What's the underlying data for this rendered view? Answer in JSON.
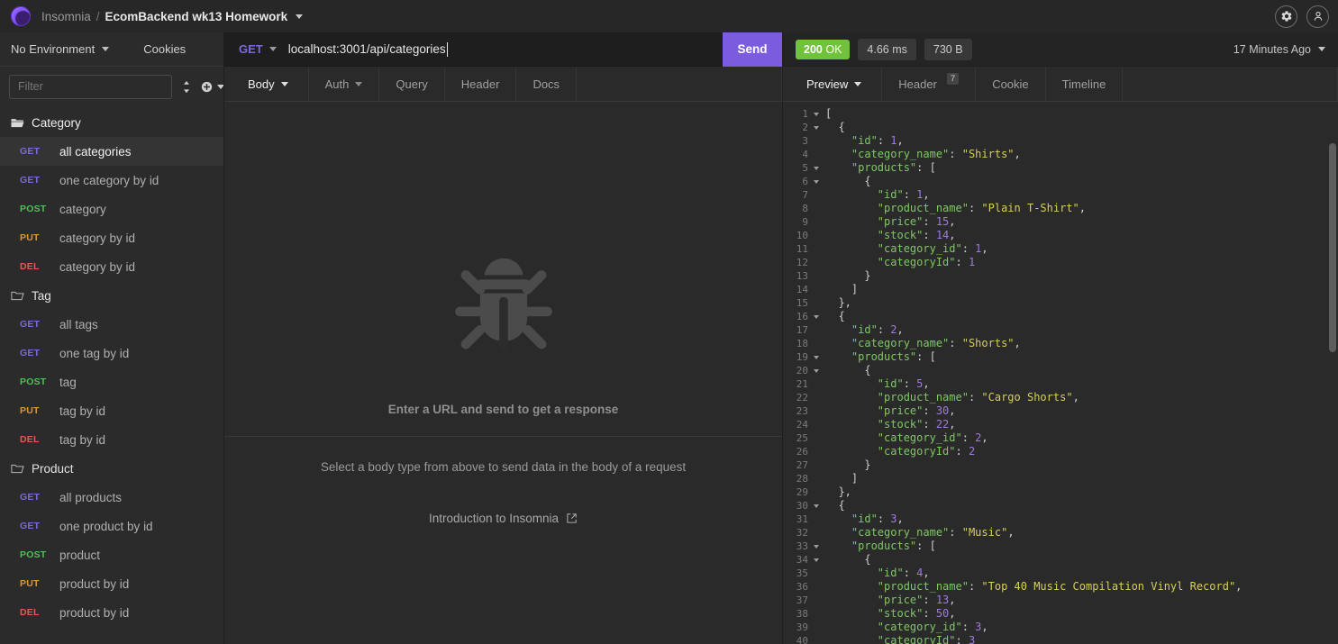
{
  "titlebar": {
    "app_name": "Insomnia",
    "separator": "/",
    "workspace": "EcomBackend wk13 Homework",
    "settings_icon": "gear-icon",
    "account_icon": "user-icon"
  },
  "sidebar": {
    "environment": "No Environment",
    "cookies": "Cookies",
    "filter_placeholder": "Filter",
    "sort_icon": "sort-icon",
    "add_icon": "plus-circle-icon",
    "folders": [
      {
        "name": "Category",
        "icon": "folder-open-icon",
        "expanded": true,
        "requests": [
          {
            "method": "GET",
            "label": "all categories",
            "selected": true
          },
          {
            "method": "GET",
            "label": "one category by id",
            "selected": false
          },
          {
            "method": "POST",
            "label": "category",
            "selected": false
          },
          {
            "method": "PUT",
            "label": "category by id",
            "selected": false
          },
          {
            "method": "DEL",
            "label": "category by id",
            "selected": false
          }
        ]
      },
      {
        "name": "Tag",
        "icon": "folder-icon",
        "expanded": true,
        "requests": [
          {
            "method": "GET",
            "label": "all tags",
            "selected": false
          },
          {
            "method": "GET",
            "label": "one tag by id",
            "selected": false
          },
          {
            "method": "POST",
            "label": "tag",
            "selected": false
          },
          {
            "method": "PUT",
            "label": "tag by id",
            "selected": false
          },
          {
            "method": "DEL",
            "label": "tag by id",
            "selected": false
          }
        ]
      },
      {
        "name": "Product",
        "icon": "folder-icon",
        "expanded": true,
        "requests": [
          {
            "method": "GET",
            "label": "all products",
            "selected": false
          },
          {
            "method": "GET",
            "label": "one product by id",
            "selected": false
          },
          {
            "method": "POST",
            "label": "product",
            "selected": false
          },
          {
            "method": "PUT",
            "label": "product by id",
            "selected": false
          },
          {
            "method": "DEL",
            "label": "product by id",
            "selected": false
          }
        ]
      }
    ]
  },
  "request": {
    "method": "GET",
    "url": "localhost:3001/api/categories",
    "send_label": "Send",
    "tabs": [
      {
        "label": "Body",
        "active": true,
        "has_caret": true
      },
      {
        "label": "Auth",
        "active": false,
        "has_caret": true
      },
      {
        "label": "Query",
        "active": false,
        "has_caret": false
      },
      {
        "label": "Header",
        "active": false,
        "has_caret": false
      },
      {
        "label": "Docs",
        "active": false,
        "has_caret": false
      }
    ],
    "empty_state": {
      "icon": "bug-icon",
      "title": "Enter a URL and send to get a response",
      "subtitle": "Select a body type from above to send data in the body of a request",
      "link": "Introduction to Insomnia",
      "link_icon": "external-link-icon"
    }
  },
  "response": {
    "status": "200",
    "status_text": "OK",
    "time": "4.66 ms",
    "size": "730 B",
    "timestamp": "17 Minutes Ago",
    "tabs": [
      {
        "label": "Preview",
        "active": true,
        "has_caret": true,
        "badge": ""
      },
      {
        "label": "Header",
        "active": false,
        "has_caret": false,
        "badge": "7"
      },
      {
        "label": "Cookie",
        "active": false,
        "has_caret": false,
        "badge": ""
      },
      {
        "label": "Timeline",
        "active": false,
        "has_caret": false,
        "badge": ""
      }
    ],
    "body_lines": [
      {
        "n": "1",
        "fold": true,
        "indent": 0,
        "segs": [
          [
            "p",
            "["
          ]
        ]
      },
      {
        "n": "2",
        "fold": true,
        "indent": 1,
        "segs": [
          [
            "p",
            "{"
          ]
        ]
      },
      {
        "n": "3",
        "fold": false,
        "indent": 2,
        "segs": [
          [
            "k",
            "\"id\""
          ],
          [
            "p",
            ": "
          ],
          [
            "n",
            "1"
          ],
          [
            "p",
            ","
          ]
        ]
      },
      {
        "n": "4",
        "fold": false,
        "indent": 2,
        "segs": [
          [
            "k",
            "\"category_name\""
          ],
          [
            "p",
            ": "
          ],
          [
            "s",
            "\"Shirts\""
          ],
          [
            "p",
            ","
          ]
        ]
      },
      {
        "n": "5",
        "fold": true,
        "indent": 2,
        "segs": [
          [
            "k",
            "\"products\""
          ],
          [
            "p",
            ": ["
          ]
        ]
      },
      {
        "n": "6",
        "fold": true,
        "indent": 3,
        "segs": [
          [
            "p",
            "{"
          ]
        ]
      },
      {
        "n": "7",
        "fold": false,
        "indent": 4,
        "segs": [
          [
            "k",
            "\"id\""
          ],
          [
            "p",
            ": "
          ],
          [
            "n",
            "1"
          ],
          [
            "p",
            ","
          ]
        ]
      },
      {
        "n": "8",
        "fold": false,
        "indent": 4,
        "segs": [
          [
            "k",
            "\"product_name\""
          ],
          [
            "p",
            ": "
          ],
          [
            "s",
            "\"Plain T-Shirt\""
          ],
          [
            "p",
            ","
          ]
        ]
      },
      {
        "n": "9",
        "fold": false,
        "indent": 4,
        "segs": [
          [
            "k",
            "\"price\""
          ],
          [
            "p",
            ": "
          ],
          [
            "n",
            "15"
          ],
          [
            "p",
            ","
          ]
        ]
      },
      {
        "n": "10",
        "fold": false,
        "indent": 4,
        "segs": [
          [
            "k",
            "\"stock\""
          ],
          [
            "p",
            ": "
          ],
          [
            "n",
            "14"
          ],
          [
            "p",
            ","
          ]
        ]
      },
      {
        "n": "11",
        "fold": false,
        "indent": 4,
        "segs": [
          [
            "k",
            "\"category_id\""
          ],
          [
            "p",
            ": "
          ],
          [
            "n",
            "1"
          ],
          [
            "p",
            ","
          ]
        ]
      },
      {
        "n": "12",
        "fold": false,
        "indent": 4,
        "segs": [
          [
            "k",
            "\"categoryId\""
          ],
          [
            "p",
            ": "
          ],
          [
            "n",
            "1"
          ]
        ]
      },
      {
        "n": "13",
        "fold": false,
        "indent": 3,
        "segs": [
          [
            "p",
            "}"
          ]
        ]
      },
      {
        "n": "14",
        "fold": false,
        "indent": 2,
        "segs": [
          [
            "p",
            "]"
          ]
        ]
      },
      {
        "n": "15",
        "fold": false,
        "indent": 1,
        "segs": [
          [
            "p",
            "},"
          ]
        ]
      },
      {
        "n": "16",
        "fold": true,
        "indent": 1,
        "segs": [
          [
            "p",
            "{"
          ]
        ]
      },
      {
        "n": "17",
        "fold": false,
        "indent": 2,
        "segs": [
          [
            "k",
            "\"id\""
          ],
          [
            "p",
            ": "
          ],
          [
            "n",
            "2"
          ],
          [
            "p",
            ","
          ]
        ]
      },
      {
        "n": "18",
        "fold": false,
        "indent": 2,
        "segs": [
          [
            "k",
            "\"category_name\""
          ],
          [
            "p",
            ": "
          ],
          [
            "s",
            "\"Shorts\""
          ],
          [
            "p",
            ","
          ]
        ]
      },
      {
        "n": "19",
        "fold": true,
        "indent": 2,
        "segs": [
          [
            "k",
            "\"products\""
          ],
          [
            "p",
            ": ["
          ]
        ]
      },
      {
        "n": "20",
        "fold": true,
        "indent": 3,
        "segs": [
          [
            "p",
            "{"
          ]
        ]
      },
      {
        "n": "21",
        "fold": false,
        "indent": 4,
        "segs": [
          [
            "k",
            "\"id\""
          ],
          [
            "p",
            ": "
          ],
          [
            "n",
            "5"
          ],
          [
            "p",
            ","
          ]
        ]
      },
      {
        "n": "22",
        "fold": false,
        "indent": 4,
        "segs": [
          [
            "k",
            "\"product_name\""
          ],
          [
            "p",
            ": "
          ],
          [
            "s",
            "\"Cargo Shorts\""
          ],
          [
            "p",
            ","
          ]
        ]
      },
      {
        "n": "23",
        "fold": false,
        "indent": 4,
        "segs": [
          [
            "k",
            "\"price\""
          ],
          [
            "p",
            ": "
          ],
          [
            "n",
            "30"
          ],
          [
            "p",
            ","
          ]
        ]
      },
      {
        "n": "24",
        "fold": false,
        "indent": 4,
        "segs": [
          [
            "k",
            "\"stock\""
          ],
          [
            "p",
            ": "
          ],
          [
            "n",
            "22"
          ],
          [
            "p",
            ","
          ]
        ]
      },
      {
        "n": "25",
        "fold": false,
        "indent": 4,
        "segs": [
          [
            "k",
            "\"category_id\""
          ],
          [
            "p",
            ": "
          ],
          [
            "n",
            "2"
          ],
          [
            "p",
            ","
          ]
        ]
      },
      {
        "n": "26",
        "fold": false,
        "indent": 4,
        "segs": [
          [
            "k",
            "\"categoryId\""
          ],
          [
            "p",
            ": "
          ],
          [
            "n",
            "2"
          ]
        ]
      },
      {
        "n": "27",
        "fold": false,
        "indent": 3,
        "segs": [
          [
            "p",
            "}"
          ]
        ]
      },
      {
        "n": "28",
        "fold": false,
        "indent": 2,
        "segs": [
          [
            "p",
            "]"
          ]
        ]
      },
      {
        "n": "29",
        "fold": false,
        "indent": 1,
        "segs": [
          [
            "p",
            "},"
          ]
        ]
      },
      {
        "n": "30",
        "fold": true,
        "indent": 1,
        "segs": [
          [
            "p",
            "{"
          ]
        ]
      },
      {
        "n": "31",
        "fold": false,
        "indent": 2,
        "segs": [
          [
            "k",
            "\"id\""
          ],
          [
            "p",
            ": "
          ],
          [
            "n",
            "3"
          ],
          [
            "p",
            ","
          ]
        ]
      },
      {
        "n": "32",
        "fold": false,
        "indent": 2,
        "segs": [
          [
            "k",
            "\"category_name\""
          ],
          [
            "p",
            ": "
          ],
          [
            "s",
            "\"Music\""
          ],
          [
            "p",
            ","
          ]
        ]
      },
      {
        "n": "33",
        "fold": true,
        "indent": 2,
        "segs": [
          [
            "k",
            "\"products\""
          ],
          [
            "p",
            ": ["
          ]
        ]
      },
      {
        "n": "34",
        "fold": true,
        "indent": 3,
        "segs": [
          [
            "p",
            "{"
          ]
        ]
      },
      {
        "n": "35",
        "fold": false,
        "indent": 4,
        "segs": [
          [
            "k",
            "\"id\""
          ],
          [
            "p",
            ": "
          ],
          [
            "n",
            "4"
          ],
          [
            "p",
            ","
          ]
        ]
      },
      {
        "n": "36",
        "fold": false,
        "indent": 4,
        "segs": [
          [
            "k",
            "\"product_name\""
          ],
          [
            "p",
            ": "
          ],
          [
            "s",
            "\"Top 40 Music Compilation Vinyl Record\""
          ],
          [
            "p",
            ","
          ]
        ]
      },
      {
        "n": "37",
        "fold": false,
        "indent": 4,
        "segs": [
          [
            "k",
            "\"price\""
          ],
          [
            "p",
            ": "
          ],
          [
            "n",
            "13"
          ],
          [
            "p",
            ","
          ]
        ]
      },
      {
        "n": "38",
        "fold": false,
        "indent": 4,
        "segs": [
          [
            "k",
            "\"stock\""
          ],
          [
            "p",
            ": "
          ],
          [
            "n",
            "50"
          ],
          [
            "p",
            ","
          ]
        ]
      },
      {
        "n": "39",
        "fold": false,
        "indent": 4,
        "segs": [
          [
            "k",
            "\"category_id\""
          ],
          [
            "p",
            ": "
          ],
          [
            "n",
            "3"
          ],
          [
            "p",
            ","
          ]
        ]
      },
      {
        "n": "40",
        "fold": false,
        "indent": 4,
        "segs": [
          [
            "k",
            "\"categoryId\""
          ],
          [
            "p",
            ": "
          ],
          [
            "n",
            "3"
          ]
        ]
      }
    ]
  }
}
